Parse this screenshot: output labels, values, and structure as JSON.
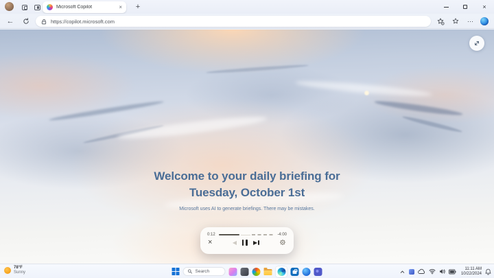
{
  "browser": {
    "tab_title": "Microsoft Copilot",
    "url": "https://copilot.microsoft.com"
  },
  "page": {
    "heading_line1": "Welcome to your daily briefing for",
    "heading_line2": "Tuesday, October 1st",
    "disclaimer": "Microsoft uses AI to generate briefings. There may be mistakes.",
    "player": {
      "elapsed": "0:12",
      "remaining": "-4:00"
    }
  },
  "taskbar": {
    "weather": {
      "temp": "78°F",
      "condition": "Sunny"
    },
    "search_label": "Search",
    "clock": {
      "time": "11:11 AM",
      "date": "10/22/2024"
    }
  },
  "icons": {
    "back": "←",
    "more": "⋯",
    "close": "×",
    "plus": "+",
    "prev": "◀",
    "play": "▶"
  },
  "colors": {
    "heading_blue": "#4a6d96",
    "chrome_background": "#eef2fa",
    "accent_blue": "#0f6cbd"
  }
}
